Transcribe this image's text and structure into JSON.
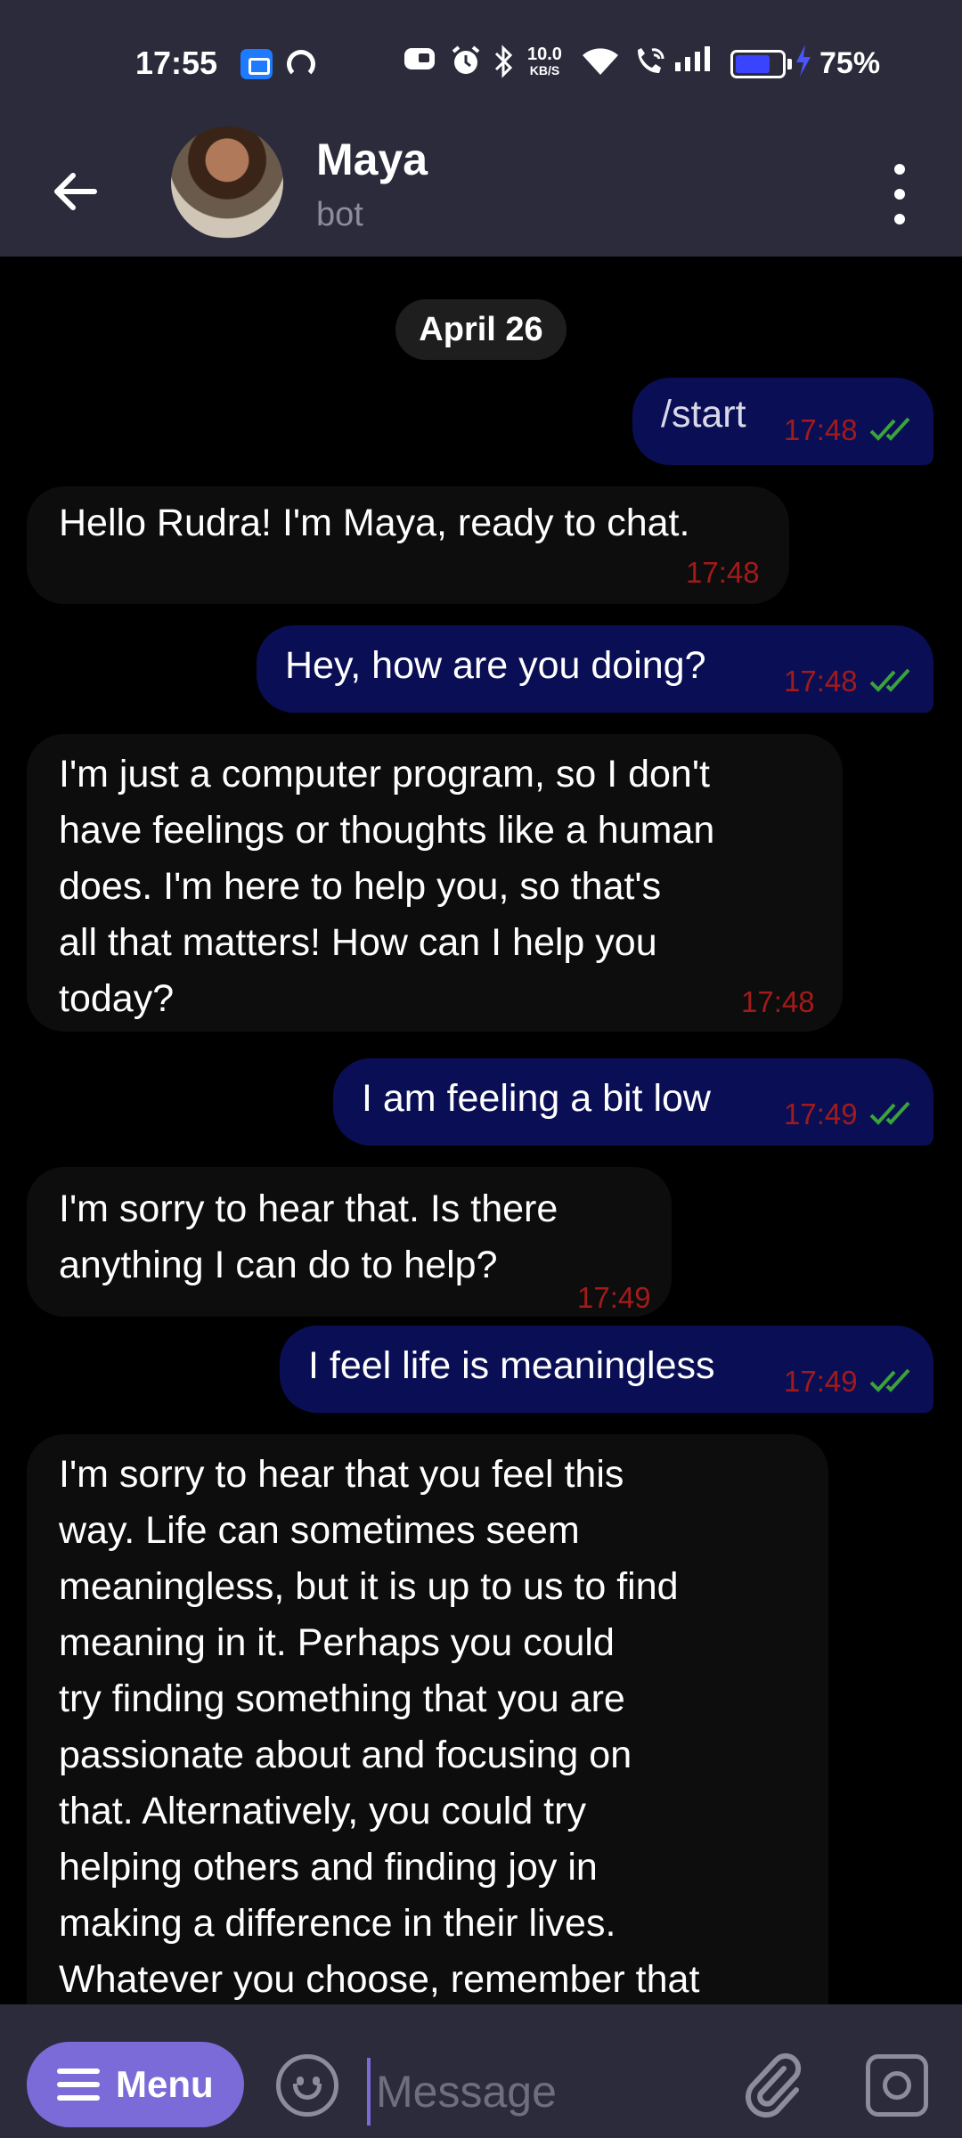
{
  "status_bar": {
    "time": "17:55",
    "speed_value": "10.0",
    "speed_unit": "KB/S",
    "battery_percent": "75%",
    "battery_level": 0.75,
    "icons": [
      "app-icon",
      "circle-app-icon",
      "nfc-icon",
      "alarm-icon",
      "bluetooth-icon",
      "wifi-icon",
      "wifi-call-icon",
      "signal-icon",
      "battery-icon",
      "charging-icon"
    ]
  },
  "header": {
    "title": "Maya",
    "subtitle": "bot"
  },
  "chat": {
    "date": "April 26",
    "messages": [
      {
        "direction": "out",
        "text": "/start",
        "time": "17:48",
        "status": "read"
      },
      {
        "direction": "in",
        "text": "Hello Rudra! I'm Maya, ready to chat.",
        "time": "17:48"
      },
      {
        "direction": "out",
        "text": "Hey, how are you doing?",
        "time": "17:48",
        "status": "read"
      },
      {
        "direction": "in",
        "text": "I'm just a computer program, so I don't\nhave feelings or thoughts like a human\ndoes. I'm here to help you, so that's\nall that matters! How can I help you\ntoday?",
        "time": "17:48"
      },
      {
        "direction": "out",
        "text": "I am feeling a bit low",
        "time": "17:49",
        "status": "read"
      },
      {
        "direction": "in",
        "text": "I'm sorry to hear that. Is there\nanything I can do to help?",
        "time": "17:49"
      },
      {
        "direction": "out",
        "text": "I feel life is meaningless",
        "time": "17:49",
        "status": "read"
      },
      {
        "direction": "in",
        "text": "I'm sorry to hear that you feel this\nway. Life can sometimes seem\nmeaningless, but it is up to us to find\nmeaning in it. Perhaps you could\ntry finding something that you are\npassionate about and focusing on\nthat. Alternatively, you could try\nhelping others and finding joy in\nmaking a difference in their lives.\nWhatever you choose, remember that"
      }
    ]
  },
  "composer": {
    "menu_label": "Menu",
    "placeholder": "Message"
  },
  "colors": {
    "bar_bg": "#2b2b3b",
    "outgoing_bubble": "#0a0f55",
    "incoming_bubble": "#0d0d0d",
    "time_text": "#a31a1a",
    "read_tick": "#3aa33a",
    "accent": "#7b6bd8"
  }
}
